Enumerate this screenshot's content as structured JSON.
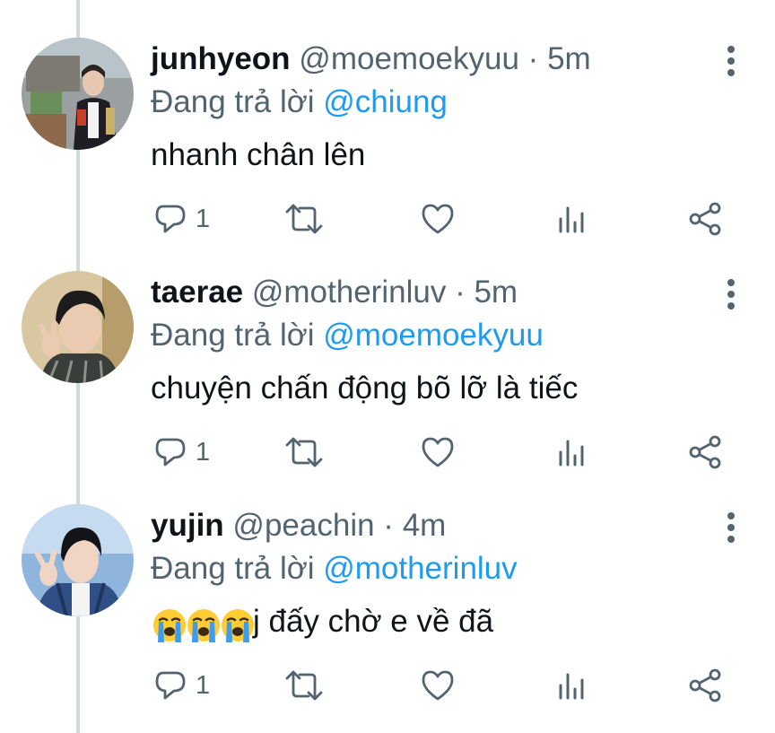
{
  "colors": {
    "link": "#1d9bf0",
    "secondary_text": "#536471",
    "primary_text": "#0f1419",
    "thread_line": "#cfd9de"
  },
  "tweets": [
    {
      "name": "junhyeon",
      "handle": "@moemoekyuu",
      "separator": "·",
      "time": "5m",
      "reply_prefix": "Đang trả lời",
      "reply_to": "@chiung",
      "text": "nhanh chân lên",
      "reply_count": "1",
      "avatar_icon": "user-avatar-photo"
    },
    {
      "name": "taerae",
      "handle": "@motherinluv",
      "separator": "·",
      "time": "5m",
      "reply_prefix": "Đang trả lời",
      "reply_to": "@moemoekyuu",
      "text": "chuyện chấn động bõ lỡ là tiếc",
      "reply_count": "1",
      "avatar_icon": "user-avatar-photo"
    },
    {
      "name": "yujin",
      "handle": "@peachin",
      "separator": "·",
      "time": "4m",
      "reply_prefix": "Đang trả lời",
      "reply_to": "@motherinluv",
      "emoji_icons": [
        "loudly-crying-face-emoji",
        "loudly-crying-face-emoji",
        "loudly-crying-face-emoji"
      ],
      "text": "j đấy chờ e về đã",
      "reply_count": "1",
      "avatar_icon": "user-avatar-photo"
    }
  ],
  "icons": {
    "reply": "reply-icon",
    "retweet": "retweet-icon",
    "like": "heart-icon",
    "analytics": "analytics-icon",
    "share": "share-icon",
    "more": "more-options-icon"
  }
}
